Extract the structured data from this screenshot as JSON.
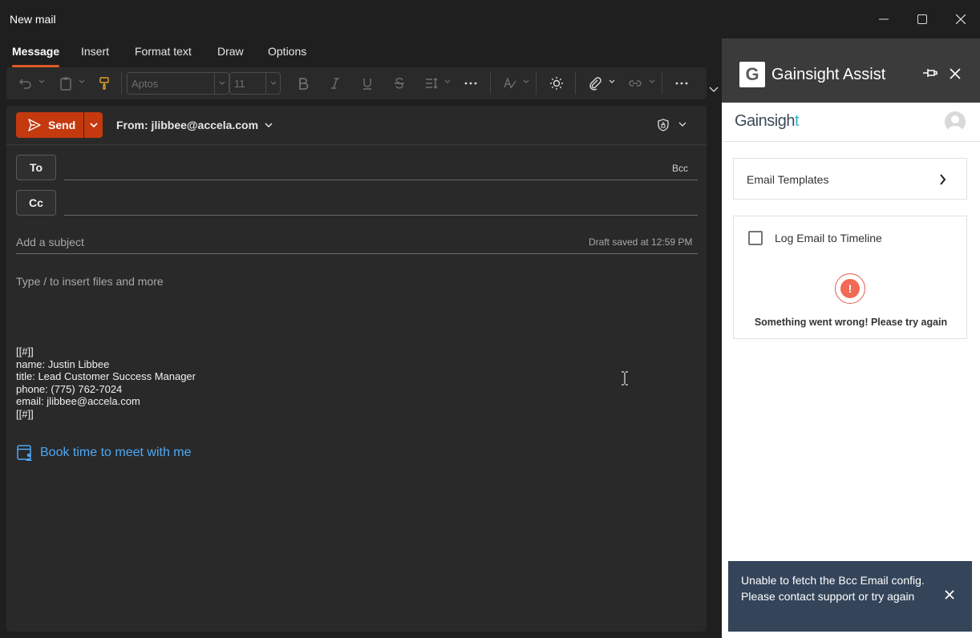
{
  "window": {
    "title": "New mail"
  },
  "ribbon": {
    "tabs": [
      {
        "label": "Message",
        "active": true
      },
      {
        "label": "Insert"
      },
      {
        "label": "Format text"
      },
      {
        "label": "Draw"
      },
      {
        "label": "Options"
      }
    ],
    "font_name": "Aptos",
    "font_size": "11"
  },
  "compose": {
    "send_label": "Send",
    "from_label": "From: jlibbee@accela.com",
    "to_label": "To",
    "cc_label": "Cc",
    "bcc_label": "Bcc",
    "subject_placeholder": "Add a subject",
    "draft_status": "Draft saved at 12:59 PM",
    "body_placeholder": "Type / to insert files and more",
    "signature": [
      "[[#]]",
      "name: Justin Libbee",
      "title: Lead Customer Success Manager",
      "phone: (775) 762-7024",
      "email: jlibbee@accela.com",
      "[[#]]"
    ],
    "book_link": "Book time to meet with me"
  },
  "gainsight": {
    "logo_letter": "G",
    "title": "Gainsight Assist",
    "brand": "Gainsigh",
    "brand_t": "t",
    "email_templates": "Email Templates",
    "log_email": "Log Email to Timeline",
    "error_glyph": "!",
    "error_message": "Something went wrong! Please try again",
    "toast": "Unable to fetch the Bcc Email config. Please contact support or try again"
  },
  "colors": {
    "send": "#c4390e",
    "accent_tab": "#e05a24",
    "link": "#4ea7f5",
    "toast_bg": "#34455a",
    "error": "#f06a55"
  }
}
